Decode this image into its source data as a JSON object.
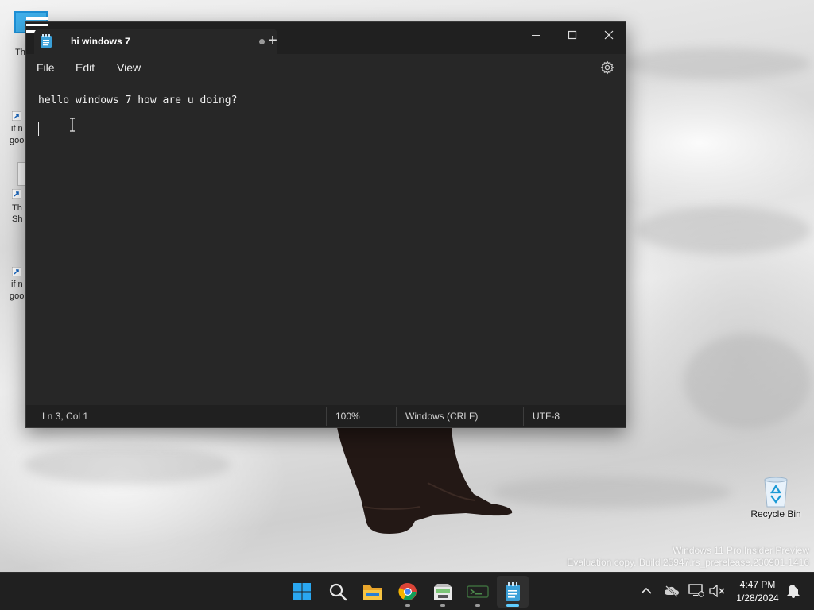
{
  "window": {
    "tab_title": "hi windows 7",
    "menu": [
      "File",
      "Edit",
      "View"
    ],
    "editor_lines": [
      "hello windows 7 how are u doing?",
      ""
    ]
  },
  "status_bar": {
    "position": "Ln 3, Col 1",
    "zoom": "100%",
    "line_ending": "Windows (CRLF)",
    "encoding": "UTF-8"
  },
  "desktop": {
    "partial_icon_labels": [
      "Th",
      "if n",
      "goo",
      "Th",
      "Sh",
      "if n",
      "goo"
    ],
    "recycle_bin_label": "Recycle Bin",
    "watermark_line1": "Windows 11 Pro Insider Preview",
    "watermark_line2": "Evaluation copy. Build 25947.rs_prerelease.230901-1416"
  },
  "taskbar": {
    "apps": [
      "start-icon",
      "search-icon",
      "file-explorer-icon",
      "chrome-icon",
      "app-icon",
      "terminal-icon",
      "notepad-icon"
    ],
    "time": "4:47 PM",
    "date": "1/28/2024"
  },
  "colors": {
    "window_bg": "#272727",
    "titlebar_bg": "#202020",
    "accent": "#60cdff"
  }
}
